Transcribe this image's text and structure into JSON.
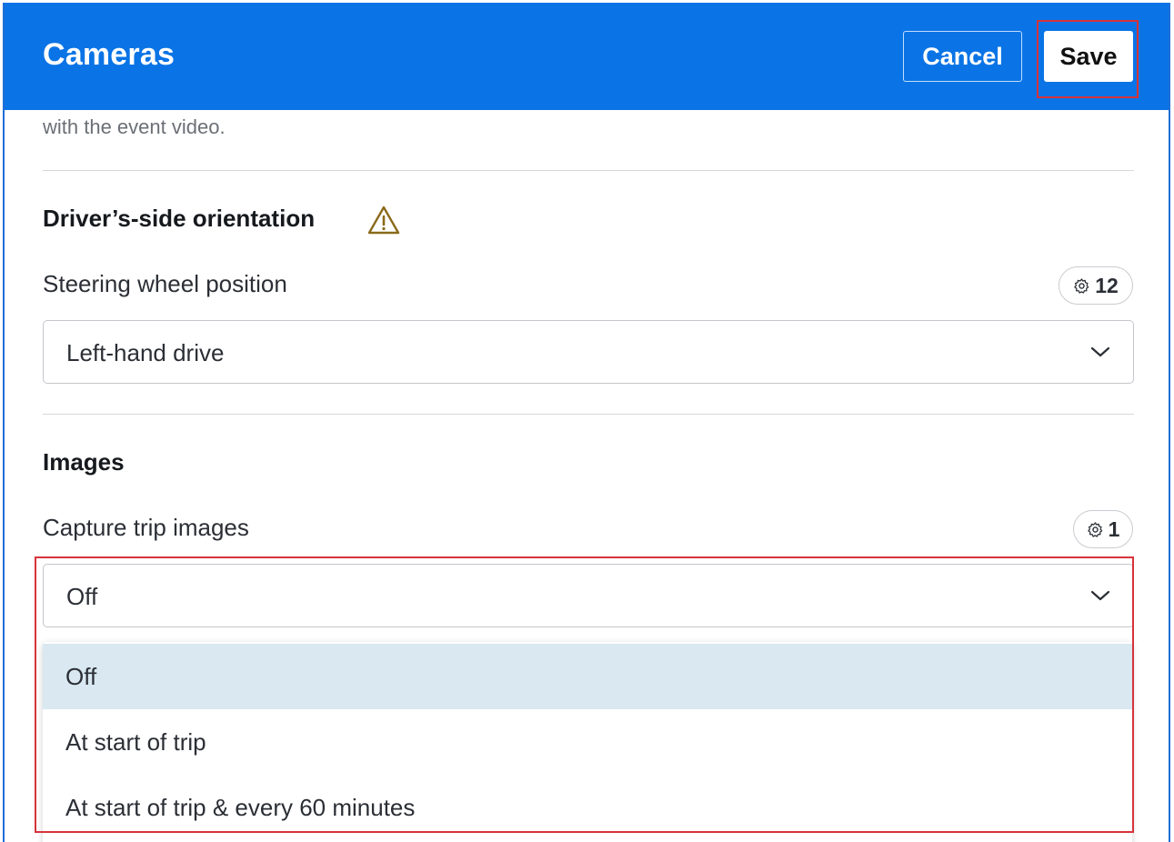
{
  "header": {
    "title": "Cameras",
    "cancel_label": "Cancel",
    "save_label": "Save",
    "background": "#0a74e6"
  },
  "intro": {
    "truncated_text": "with the event video."
  },
  "driver_side": {
    "section_title": "Driver’s-side orientation",
    "warning_icon": "warning-triangle-icon",
    "field_label": "Steering wheel position",
    "badge_icon": "gear-icon",
    "badge_count": "12",
    "selected_value": "Left-hand drive"
  },
  "images": {
    "section_title": "Images",
    "field_label": "Capture trip images",
    "badge_icon": "gear-icon",
    "badge_count": "1",
    "selected_value": "Off",
    "options": [
      {
        "label": "Off",
        "selected": true
      },
      {
        "label": "At start of trip",
        "selected": false
      },
      {
        "label": "At start of trip & every 60 minutes",
        "selected": false
      }
    ]
  },
  "colors": {
    "accent": "#0a74e6",
    "selected_option": "#d9e8f1",
    "highlight": "#d6333b",
    "warning": "#8a6a1a"
  }
}
